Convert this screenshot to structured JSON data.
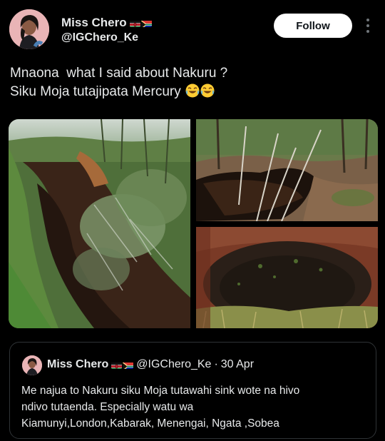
{
  "author": {
    "name": "Miss Chero",
    "handle": "@IGChero_Ke"
  },
  "follow_label": "Follow",
  "tweet": {
    "lines": [
      "Mnaona  what I said about Nakuru ?",
      "Siku Moja tutajipata Mercury"
    ]
  },
  "quote": {
    "name": "Miss Chero",
    "handle": "@IGChero_Ke",
    "separator": "·",
    "date": "30 Apr",
    "lines": [
      "Me najua to Nakuru siku Moja tutawahi sink wote na hivo",
      "ndivo tutaenda. Especially watu wa",
      "Kiamunyi,London,Kabarak, Menengai, Ngata ,Sobea"
    ]
  },
  "colors": {
    "background": "#000000",
    "text": "#e7e9ea",
    "border": "#2f3336",
    "follow_bg": "#ffffff"
  }
}
